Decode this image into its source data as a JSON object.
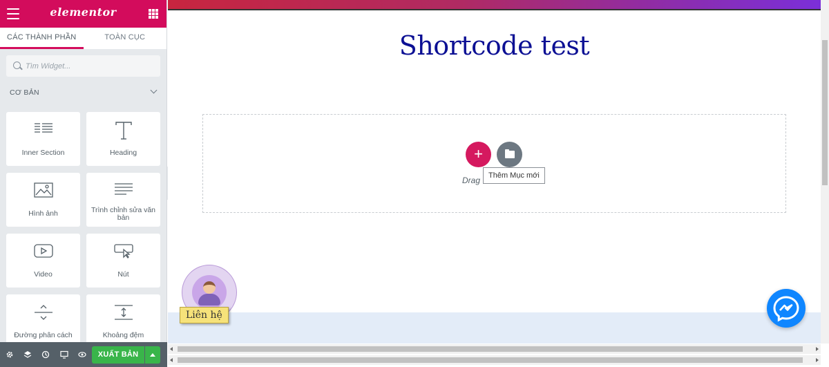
{
  "panel": {
    "logo": "elementor",
    "tabs": [
      {
        "label": "CÁC THÀNH PHẦN",
        "active": true
      },
      {
        "label": "TOÀN CỤC",
        "active": false
      }
    ],
    "search": {
      "placeholder": "Tìm Widget..."
    },
    "category": "CƠ BẢN",
    "widgets": [
      {
        "label": "Inner Section",
        "icon": "inner-section-icon"
      },
      {
        "label": "Heading",
        "icon": "heading-icon"
      },
      {
        "label": "Hình ảnh",
        "icon": "image-icon"
      },
      {
        "label": "Trình chỉnh sửa văn bản",
        "icon": "text-editor-icon"
      },
      {
        "label": "Video",
        "icon": "video-icon"
      },
      {
        "label": "Nút",
        "icon": "button-icon"
      },
      {
        "label": "Đường phân cách",
        "icon": "divider-icon"
      },
      {
        "label": "Khoảng đệm",
        "icon": "spacer-icon"
      }
    ],
    "footer": {
      "icons": [
        "settings-icon",
        "navigator-icon",
        "history-icon",
        "responsive-icon",
        "preview-icon"
      ],
      "publish_label": "XUẤT BẢN"
    }
  },
  "preview": {
    "page_title": "Shortcode test",
    "drag_text": "Drag",
    "add_section_tooltip": "Thêm Mục mới",
    "contact_label": "Liên hệ"
  },
  "colors": {
    "brand": "#d30c5c",
    "publish": "#39b54a",
    "title": "#0c1094",
    "messenger": "#0f86ff"
  }
}
